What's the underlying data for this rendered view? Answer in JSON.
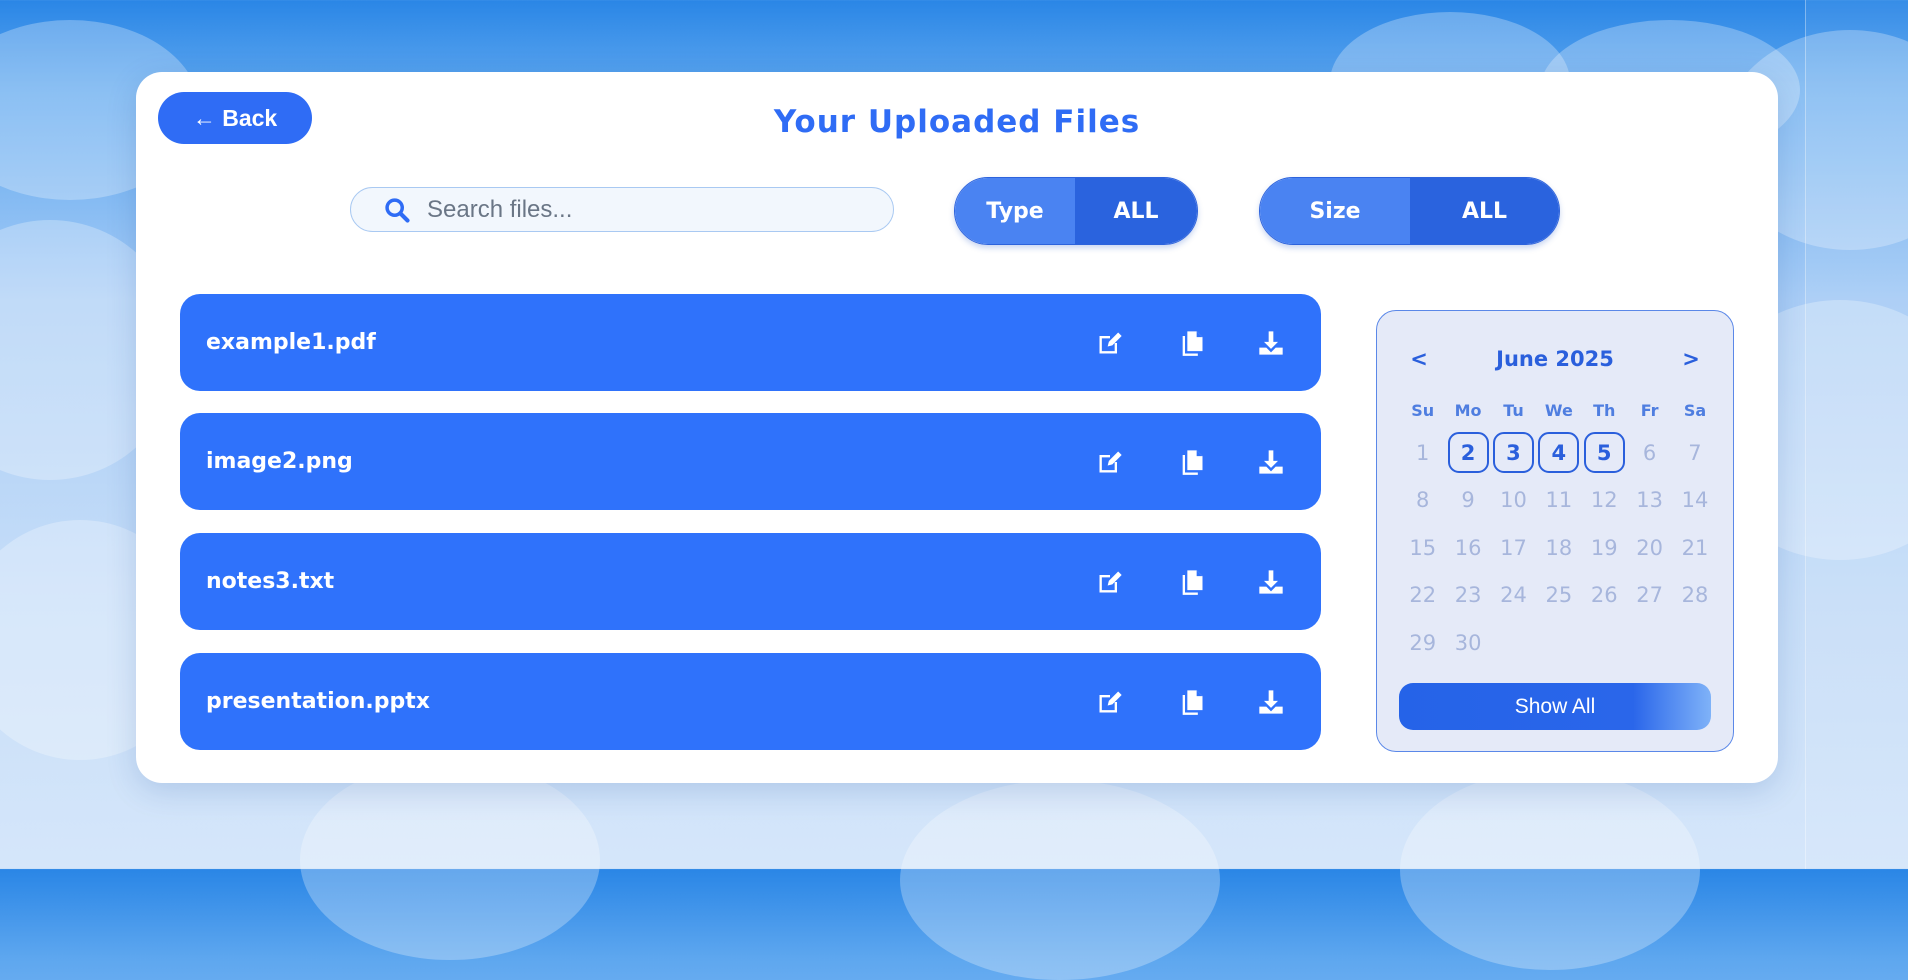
{
  "header": {
    "back_label": "← Back",
    "title": "Your Uploaded Files"
  },
  "search": {
    "placeholder": "Search files...",
    "value": ""
  },
  "filters": {
    "type": {
      "label": "Type",
      "value": "ALL"
    },
    "size": {
      "label": "Size",
      "value": "ALL"
    }
  },
  "files": [
    {
      "name": "example1.pdf"
    },
    {
      "name": "image2.png"
    },
    {
      "name": "notes3.txt"
    },
    {
      "name": "presentation.pptx"
    }
  ],
  "file_actions": [
    "edit-icon",
    "copy-icon",
    "download-icon"
  ],
  "calendar": {
    "prev": "<",
    "next": ">",
    "month_label": "June 2025",
    "weekdays": [
      "Su",
      "Mo",
      "Tu",
      "We",
      "Th",
      "Fr",
      "Sa"
    ],
    "weeks": [
      [
        "1",
        "2",
        "3",
        "4",
        "5",
        "6",
        "7"
      ],
      [
        "8",
        "9",
        "10",
        "11",
        "12",
        "13",
        "14"
      ],
      [
        "15",
        "16",
        "17",
        "18",
        "19",
        "20",
        "21"
      ],
      [
        "22",
        "23",
        "24",
        "25",
        "26",
        "27",
        "28"
      ],
      [
        "29",
        "30",
        "",
        "",
        "",
        "",
        ""
      ]
    ],
    "highlighted": [
      "2",
      "3",
      "4",
      "5"
    ],
    "show_all_label": "Show All"
  },
  "colors": {
    "accent": "#2f6cf5",
    "row": "#2f72fb",
    "calendar_bg": "#e5eaf8"
  }
}
